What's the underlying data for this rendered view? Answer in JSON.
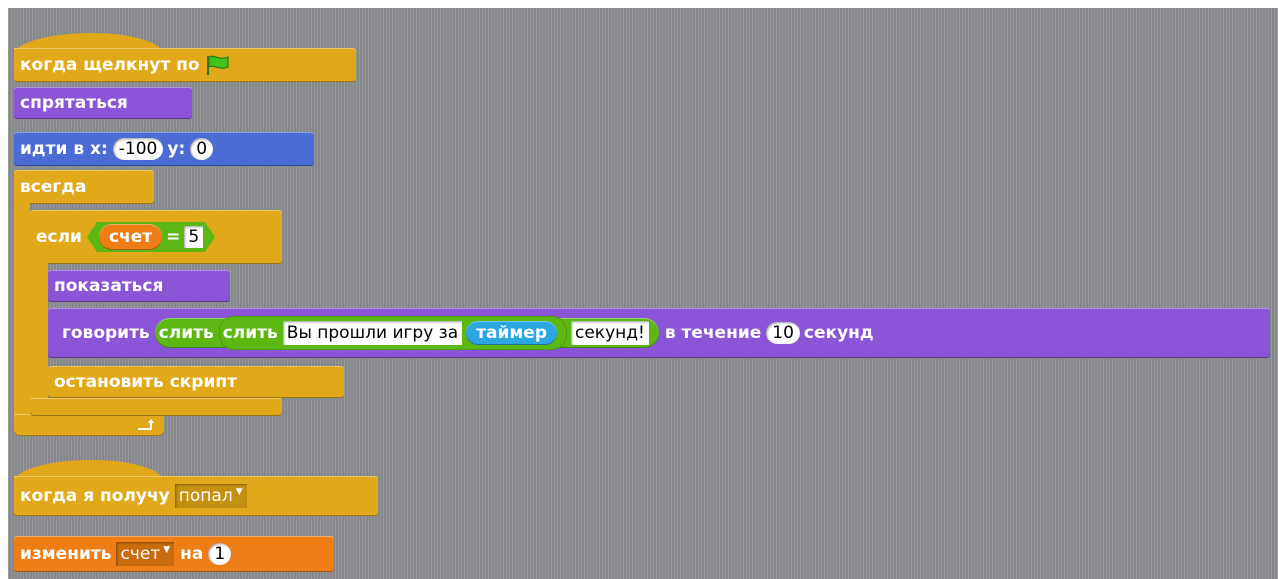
{
  "script1": {
    "hat": "когда щелкнут по",
    "hat_icon": "green-flag-icon",
    "hide": "спрятаться",
    "goto_label": "идти в x:",
    "goto_x": "-100",
    "goto_y_label": "y:",
    "goto_y": "0",
    "forever": "всегда",
    "if_label": "если",
    "if_var": "счет",
    "if_op": "=",
    "if_value": "5",
    "show": "показаться",
    "say_label": "говорить",
    "join_outer": "слить",
    "join_inner": "слить",
    "join_text1": "Вы прошли игру за",
    "timer": "таймер",
    "join_text2": "секунд!",
    "for_label": "в течение",
    "for_secs": "10",
    "secs_label": "секунд",
    "stop": "остановить скрипт"
  },
  "script2": {
    "hat": "когда я получу",
    "message": "попал",
    "change_label": "изменить",
    "change_var": "счет",
    "by_label": "на",
    "by_value": "1"
  },
  "colors": {
    "control": "#e1a91a",
    "looks": "#8a55d7",
    "motion": "#4a6cd4",
    "variables": "#ee7d16",
    "operators": "#5cb712",
    "sensing": "#2ca5e2",
    "canvas": "#8e9094"
  }
}
